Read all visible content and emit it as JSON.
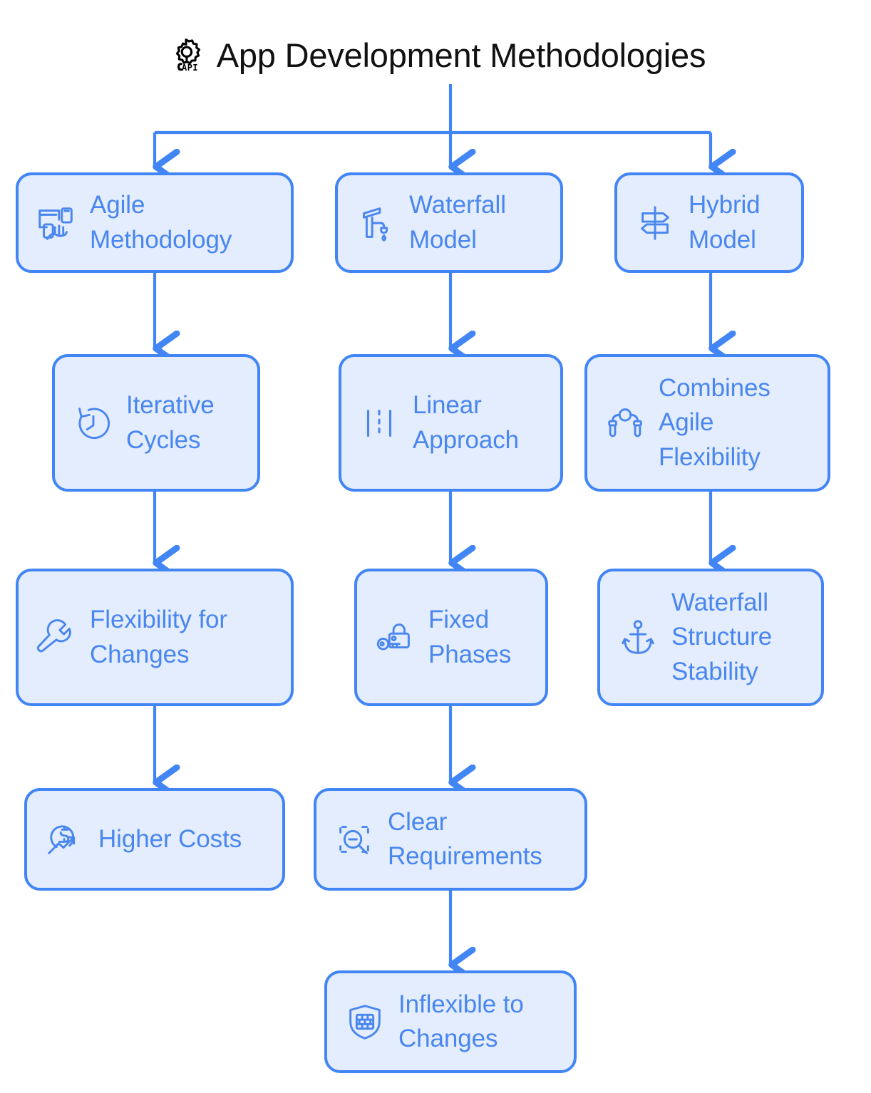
{
  "header": {
    "title": "App Development Methodologies",
    "icon": "api-gear-icon",
    "icon_text": "API"
  },
  "theme": {
    "node_fill": "#e3edfd",
    "node_border": "#4285f4",
    "node_text": "#4a86ef",
    "connector": "#4285f4",
    "title_text": "#111111",
    "background": "#ffffff"
  },
  "diagram": {
    "type": "flowchart",
    "orientation": "top-down",
    "branch_count": 3,
    "columns": [
      {
        "name": "agile-branch",
        "nodes": [
          {
            "id": "agile-methodology",
            "label": "Agile\nMethodology",
            "icon": "devices-hand-icon"
          },
          {
            "id": "iterative-cycles",
            "label": "Iterative\nCycles",
            "icon": "clock-rotate-icon"
          },
          {
            "id": "flexibility-for-changes",
            "label": "Flexibility for\nChanges",
            "icon": "wrench-icon"
          },
          {
            "id": "higher-costs",
            "label": "Higher Costs",
            "icon": "dollar-trend-up-icon"
          }
        ]
      },
      {
        "name": "waterfall-branch",
        "nodes": [
          {
            "id": "waterfall-model",
            "label": "Waterfall\nModel",
            "icon": "faucet-drip-icon"
          },
          {
            "id": "linear-approach",
            "label": "Linear\nApproach",
            "icon": "lane-lines-icon"
          },
          {
            "id": "fixed-phases",
            "label": "Fixed\nPhases",
            "icon": "lock-key-icon"
          },
          {
            "id": "clear-requirements",
            "label": "Clear\nRequirements",
            "icon": "zoom-out-selection-icon"
          },
          {
            "id": "inflexible-to-changes",
            "label": "Inflexible to\nChanges",
            "icon": "shield-wall-icon"
          }
        ]
      },
      {
        "name": "hybrid-branch",
        "nodes": [
          {
            "id": "hybrid-model",
            "label": "Hybrid\nModel",
            "icon": "signpost-icon"
          },
          {
            "id": "combines-agile-flexibility",
            "label": "Combines\nAgile\nFlexibility",
            "icon": "jump-rope-icon"
          },
          {
            "id": "waterfall-structure-stability",
            "label": "Waterfall\nStructure\nStability",
            "icon": "anchor-icon"
          }
        ]
      }
    ],
    "edges": [
      {
        "from": "title",
        "to": "agile-methodology"
      },
      {
        "from": "title",
        "to": "waterfall-model"
      },
      {
        "from": "title",
        "to": "hybrid-model"
      },
      {
        "from": "agile-methodology",
        "to": "iterative-cycles"
      },
      {
        "from": "iterative-cycles",
        "to": "flexibility-for-changes"
      },
      {
        "from": "flexibility-for-changes",
        "to": "higher-costs"
      },
      {
        "from": "waterfall-model",
        "to": "linear-approach"
      },
      {
        "from": "linear-approach",
        "to": "fixed-phases"
      },
      {
        "from": "fixed-phases",
        "to": "clear-requirements"
      },
      {
        "from": "clear-requirements",
        "to": "inflexible-to-changes"
      },
      {
        "from": "hybrid-model",
        "to": "combines-agile-flexibility"
      },
      {
        "from": "combines-agile-flexibility",
        "to": "waterfall-structure-stability"
      }
    ]
  }
}
